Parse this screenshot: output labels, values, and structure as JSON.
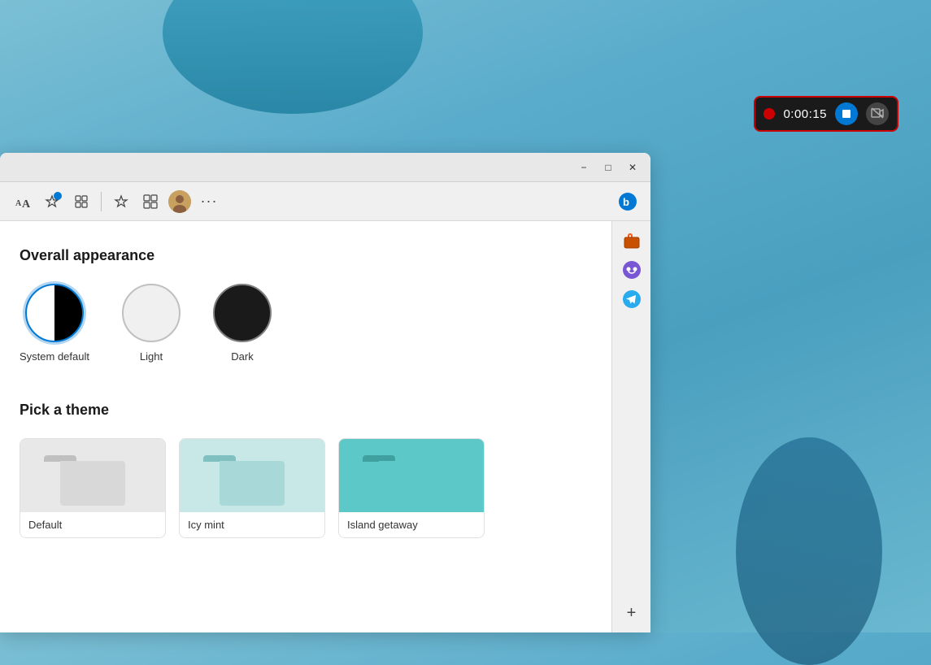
{
  "desktop": {
    "bg_color_start": "#7bbfd4",
    "bg_color_end": "#4a9fbf"
  },
  "recording_toolbar": {
    "timer": "0:00:15",
    "stop_label": "Stop",
    "camera_label": "Camera"
  },
  "browser": {
    "title_bar": {
      "minimize_label": "−",
      "maximize_label": "□",
      "close_label": "✕"
    },
    "toolbar": {
      "font_icon": "A",
      "favorites_icon": "☆",
      "extensions_icon": "🧩",
      "split_icon": "⊡",
      "workspaces_icon": "⊞",
      "profile_icon": "👤",
      "more_icon": "···",
      "bing_icon": "b"
    },
    "sidebar": {
      "items": [
        {
          "name": "briefcase",
          "color": "#c85000"
        },
        {
          "name": "copilot",
          "color": "#7856d4"
        },
        {
          "name": "telegram",
          "color": "#2aabee"
        },
        {
          "name": "add",
          "label": "+"
        }
      ]
    },
    "content": {
      "overall_appearance": {
        "title": "Overall appearance",
        "options": [
          {
            "id": "system-default",
            "label": "System default",
            "type": "half"
          },
          {
            "id": "light",
            "label": "Light",
            "type": "light"
          },
          {
            "id": "dark",
            "label": "Dark",
            "type": "dark"
          }
        ]
      },
      "pick_a_theme": {
        "title": "Pick a theme",
        "themes": [
          {
            "id": "default",
            "label": "Default",
            "tab_color": "#c0c0c0",
            "body_color": "#d8d8d8",
            "bg": "#e8e8e8"
          },
          {
            "id": "icy-mint",
            "label": "Icy mint",
            "tab_color": "#80c0c0",
            "body_color": "#a8d8d8",
            "bg": "#c8e8e8"
          },
          {
            "id": "island-getaway",
            "label": "Island getaway",
            "tab_color": "#40a0a0",
            "body_color": "#5cc8c8",
            "bg": "#5cc8c8"
          }
        ]
      }
    }
  }
}
